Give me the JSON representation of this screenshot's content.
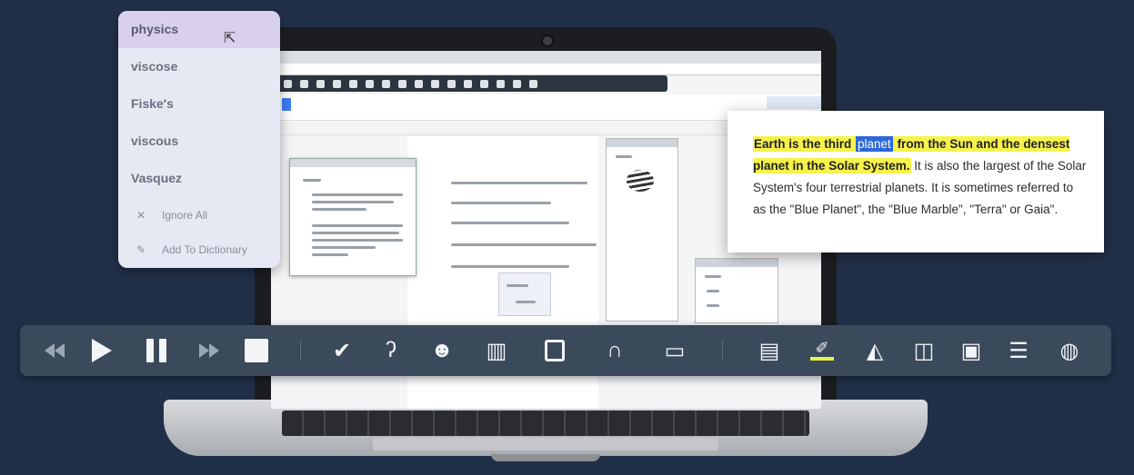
{
  "spell_menu": {
    "suggestions": [
      "physics",
      "viscose",
      "Fiske's",
      "viscous",
      "Vasquez"
    ],
    "actions": [
      {
        "label": "Ignore All",
        "icon": "close-icon"
      },
      {
        "label": "Add To Dictionary",
        "icon": "pencil-icon"
      }
    ]
  },
  "text_card": {
    "highlight_1": "Earth is the third ",
    "selected_word": "planet",
    "highlight_2": " from the Sun and the densest planet in the Solar System.",
    "rest": " It is also the largest of the Solar System's four terrestrial planets. It is sometimes referred to as the \"Blue Planet\", the \"Blue Marble\", \"Terra\" or Gaia\"."
  },
  "toolbar": {
    "buttons": [
      {
        "name": "rewind-button",
        "icon": "rewind-icon"
      },
      {
        "name": "play-button",
        "icon": "play-icon"
      },
      {
        "name": "pause-button",
        "icon": "pause-icon"
      },
      {
        "name": "fast-forward-button",
        "icon": "fast-forward-icon"
      },
      {
        "name": "stop-button",
        "icon": "stop-icon"
      },
      {
        "name": "spell-check-button",
        "icon": "check-circle-icon"
      },
      {
        "name": "hearing-button",
        "icon": "ear-icon"
      },
      {
        "name": "speech-maker-button",
        "icon": "talking-head-icon"
      },
      {
        "name": "dictionary-button",
        "icon": "book-icon"
      },
      {
        "name": "screen-reader-button",
        "icon": "select-cursor-icon"
      },
      {
        "name": "audio-button",
        "icon": "headphones-icon"
      },
      {
        "name": "screenshot-button",
        "icon": "monitor-icon"
      },
      {
        "name": "document-button",
        "icon": "document-icon"
      },
      {
        "name": "highlighter-button",
        "icon": "highlighter-icon"
      },
      {
        "name": "clear-highlight-button",
        "icon": "eraser-icon"
      },
      {
        "name": "translate-button",
        "icon": "translate-icon"
      },
      {
        "name": "video-button",
        "icon": "video-icon"
      },
      {
        "name": "list-button",
        "icon": "list-icon"
      },
      {
        "name": "audio-maker-button",
        "icon": "speaker-icon"
      }
    ],
    "colors": {
      "background": "#3b4a5b",
      "icon": "#f2f4f7",
      "highlight": "#e9f24a"
    }
  },
  "colors": {
    "page_background": "#213049",
    "selection": "#2b67d6",
    "highlight": "#f6f24b"
  }
}
